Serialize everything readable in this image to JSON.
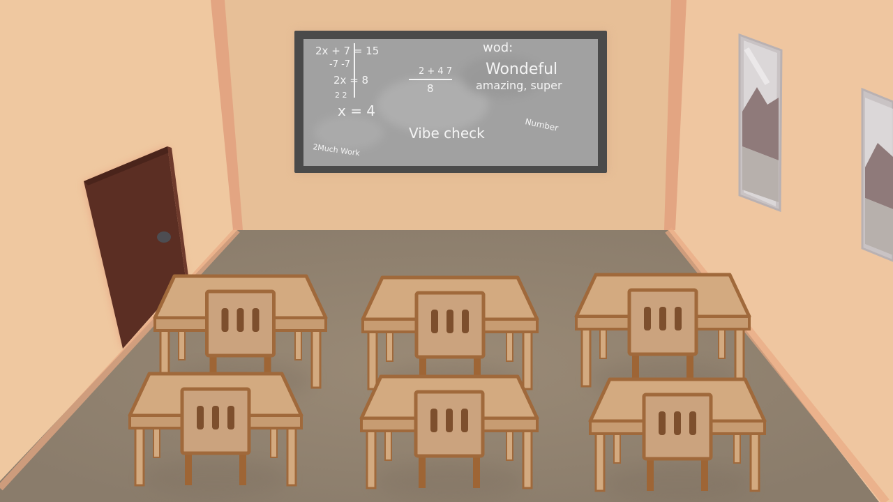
{
  "colors": {
    "wall": "#e7bf97",
    "wall_shadow": "#e5ab86",
    "floor": "#948674",
    "board_frame": "#4a4a4a",
    "board_surface": "#9f9f9f",
    "door": "#5b2e23",
    "desk_top": "#d3aa80",
    "desk_edge": "#a0693b",
    "chair": "#cba37e",
    "chair_slot": "#7d4f2d"
  },
  "chalkboard": {
    "equation_lines": [
      "2x + 7 = 15",
      "-7   -7",
      "2x = 8",
      "2   2",
      "x = 4"
    ],
    "fraction_top": "2 + 4 7",
    "fraction_bottom": "8",
    "word_heading": "wod:",
    "word": "Wondeful",
    "synonyms": "amazing, super",
    "vibe_check": "Vibe check",
    "number_note": "Number",
    "corner_note": "2Much Work"
  },
  "desks": {
    "count": 6,
    "rows": 2,
    "columns": 3
  },
  "posters": [
    {
      "name": "poster-left",
      "icon": "mountain-icon"
    },
    {
      "name": "poster-right",
      "icon": "mountain-icon"
    }
  ]
}
